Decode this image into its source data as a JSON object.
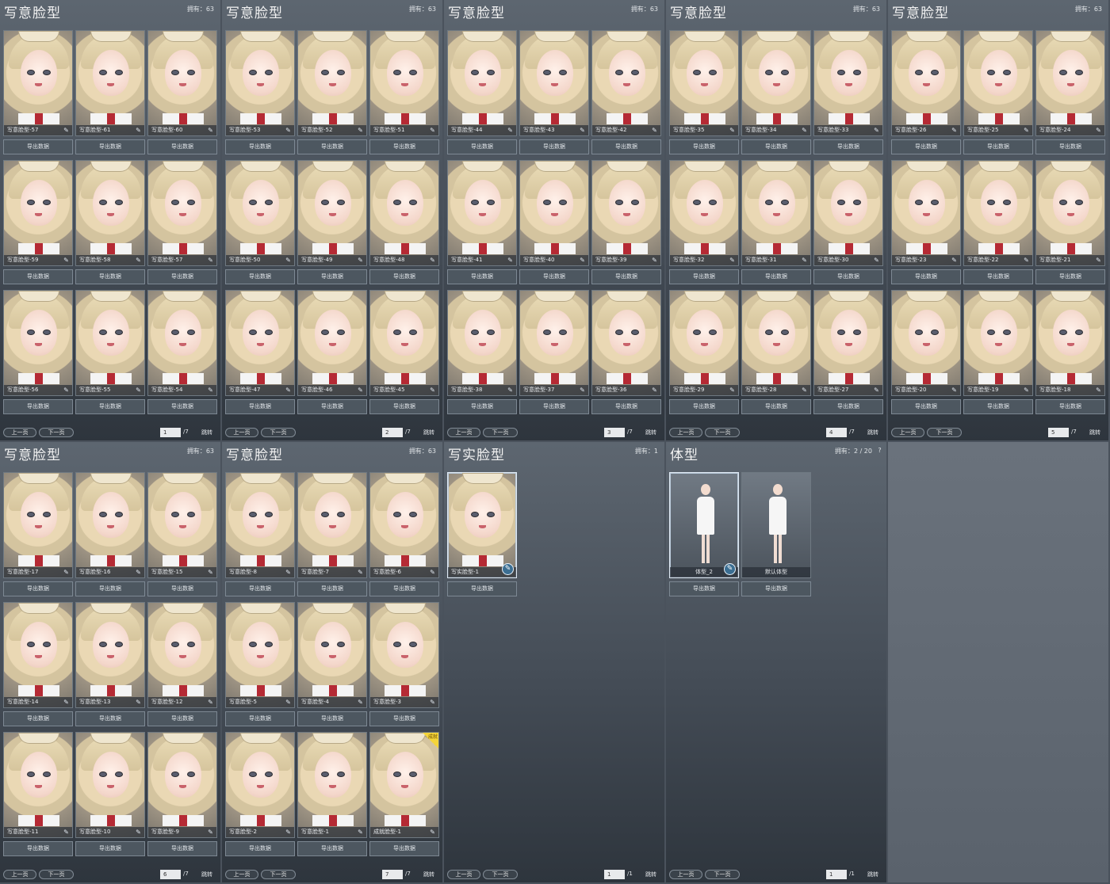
{
  "panels": [
    {
      "title": "写意脸型",
      "count_label": "拥有：",
      "count": "63",
      "rows": 3,
      "cards": [
        {
          "name": "写意脸型-57",
          "button": "导出数据"
        },
        {
          "name": "写意脸型-61",
          "button": "导出数据"
        },
        {
          "name": "写意脸型-60",
          "button": "导出数据"
        },
        {
          "name": "写意脸型-59",
          "button": "导出数据"
        },
        {
          "name": "写意脸型-58",
          "button": "导出数据"
        },
        {
          "name": "写意脸型-57",
          "button": "导出数据"
        },
        {
          "name": "写意脸型-56",
          "button": "导出数据"
        },
        {
          "name": "写意脸型-55",
          "button": "导出数据"
        },
        {
          "name": "写意脸型-54",
          "button": "导出数据"
        }
      ],
      "prev": "上一页",
      "next": "下一页",
      "page": "1",
      "total": "/7",
      "jump": "跳转"
    },
    {
      "title": "写意脸型",
      "count_label": "拥有：",
      "count": "63",
      "rows": 3,
      "cards": [
        {
          "name": "写意脸型-53",
          "button": "导出数据"
        },
        {
          "name": "写意脸型-52",
          "button": "导出数据"
        },
        {
          "name": "写意脸型-51",
          "button": "导出数据"
        },
        {
          "name": "写意脸型-50",
          "button": "导出数据"
        },
        {
          "name": "写意脸型-49",
          "button": "导出数据"
        },
        {
          "name": "写意脸型-48",
          "button": "导出数据"
        },
        {
          "name": "写意脸型-47",
          "button": "导出数据"
        },
        {
          "name": "写意脸型-46",
          "button": "导出数据"
        },
        {
          "name": "写意脸型-45",
          "button": "导出数据"
        }
      ],
      "prev": "上一页",
      "next": "下一页",
      "page": "2",
      "total": "/7",
      "jump": "跳转"
    },
    {
      "title": "写意脸型",
      "count_label": "拥有：",
      "count": "63",
      "rows": 3,
      "cards": [
        {
          "name": "写意脸型-44",
          "button": "导出数据"
        },
        {
          "name": "写意脸型-43",
          "button": "导出数据"
        },
        {
          "name": "写意脸型-42",
          "button": "导出数据"
        },
        {
          "name": "写意脸型-41",
          "button": "导出数据"
        },
        {
          "name": "写意脸型-40",
          "button": "导出数据"
        },
        {
          "name": "写意脸型-39",
          "button": "导出数据"
        },
        {
          "name": "写意脸型-38",
          "button": "导出数据"
        },
        {
          "name": "写意脸型-37",
          "button": "导出数据"
        },
        {
          "name": "写意脸型-36",
          "button": "导出数据"
        }
      ],
      "prev": "上一页",
      "next": "下一页",
      "page": "3",
      "total": "/7",
      "jump": "跳转"
    },
    {
      "title": "写意脸型",
      "count_label": "拥有：",
      "count": "63",
      "rows": 3,
      "cards": [
        {
          "name": "写意脸型-35",
          "button": "导出数据"
        },
        {
          "name": "写意脸型-34",
          "button": "导出数据"
        },
        {
          "name": "写意脸型-33",
          "button": "导出数据"
        },
        {
          "name": "写意脸型-32",
          "button": "导出数据"
        },
        {
          "name": "写意脸型-31",
          "button": "导出数据"
        },
        {
          "name": "写意脸型-30",
          "button": "导出数据"
        },
        {
          "name": "写意脸型-29",
          "button": "导出数据"
        },
        {
          "name": "写意脸型-28",
          "button": "导出数据"
        },
        {
          "name": "写意脸型-27",
          "button": "导出数据"
        }
      ],
      "prev": "上一页",
      "next": "下一页",
      "page": "4",
      "total": "/7",
      "jump": "跳转"
    },
    {
      "title": "写意脸型",
      "count_label": "拥有：",
      "count": "63",
      "rows": 3,
      "cards": [
        {
          "name": "写意脸型-26",
          "button": "导出数据"
        },
        {
          "name": "写意脸型-25",
          "button": "导出数据"
        },
        {
          "name": "写意脸型-24",
          "button": "导出数据"
        },
        {
          "name": "写意脸型-23",
          "button": "导出数据"
        },
        {
          "name": "写意脸型-22",
          "button": "导出数据"
        },
        {
          "name": "写意脸型-21",
          "button": "导出数据"
        },
        {
          "name": "写意脸型-20",
          "button": "导出数据"
        },
        {
          "name": "写意脸型-19",
          "button": "导出数据"
        },
        {
          "name": "写意脸型-18",
          "button": "导出数据"
        }
      ],
      "prev": "上一页",
      "next": "下一页",
      "page": "5",
      "total": "/7",
      "jump": "跳转"
    },
    {
      "title": "写意脸型",
      "count_label": "拥有：",
      "count": "63",
      "rows": 3,
      "cards": [
        {
          "name": "写意脸型-17",
          "button": "导出数据"
        },
        {
          "name": "写意脸型-16",
          "button": "导出数据"
        },
        {
          "name": "写意脸型-15",
          "button": "导出数据"
        },
        {
          "name": "写意脸型-14",
          "button": "导出数据"
        },
        {
          "name": "写意脸型-13",
          "button": "导出数据"
        },
        {
          "name": "写意脸型-12",
          "button": "导出数据"
        },
        {
          "name": "写意脸型-11",
          "button": "导出数据"
        },
        {
          "name": "写意脸型-10",
          "button": "导出数据"
        },
        {
          "name": "写意脸型-9",
          "button": "导出数据"
        }
      ],
      "prev": "上一页",
      "next": "下一页",
      "page": "6",
      "total": "/7",
      "jump": "跳转"
    },
    {
      "title": "写意脸型",
      "count_label": "拥有：",
      "count": "63",
      "rows": 3,
      "cards": [
        {
          "name": "写意脸型-8",
          "button": "导出数据"
        },
        {
          "name": "写意脸型-7",
          "button": "导出数据"
        },
        {
          "name": "写意脸型-6",
          "button": "导出数据"
        },
        {
          "name": "写意脸型-5",
          "button": "导出数据"
        },
        {
          "name": "写意脸型-4",
          "button": "导出数据"
        },
        {
          "name": "写意脸型-3",
          "button": "导出数据"
        },
        {
          "name": "写意脸型-2",
          "button": "导出数据"
        },
        {
          "name": "写意脸型-1",
          "button": "导出数据"
        },
        {
          "name": "成就脸型-1",
          "button": "导出数据",
          "badge": "成就"
        }
      ],
      "prev": "上一页",
      "next": "下一页",
      "page": "7",
      "total": "/7",
      "jump": "跳转"
    },
    {
      "title": "写实脸型",
      "count_label": "拥有：",
      "count": "1",
      "rows": 1,
      "cards": [
        {
          "name": "写实脸型-1",
          "button": "导出数据",
          "selected": true
        }
      ],
      "prev": "上一页",
      "next": "下一页",
      "page": "1",
      "total": "/1",
      "jump": "跳转"
    },
    {
      "title": "体型",
      "count_label": "拥有：",
      "count": "2 / 20",
      "help": "?",
      "rows": 1,
      "body": true,
      "cards": [
        {
          "name": "体型_2",
          "button": "导出数据",
          "selected": true
        },
        {
          "name": "默认体型",
          "button": "导出数据"
        }
      ],
      "prev": "上一页",
      "next": "下一页",
      "page": "1",
      "total": "/1",
      "jump": "跳转"
    },
    {
      "empty": true
    }
  ],
  "colors": {
    "accent": "#3b6e92",
    "badge": "#f4d43a",
    "lip": "#b52a34"
  }
}
